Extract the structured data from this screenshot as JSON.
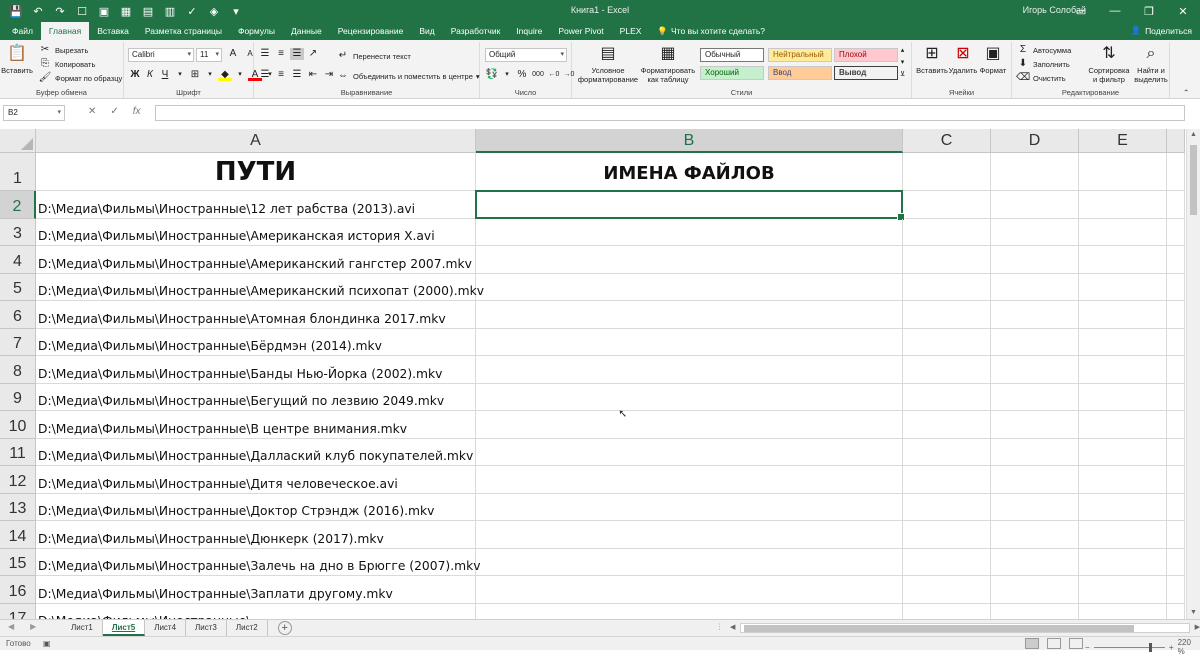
{
  "window": {
    "title": "Книга1  -  Excel",
    "user": "Игорь Солобай",
    "share": "Поделиться",
    "icons": [
      "save-icon",
      "undo-icon",
      "redo-icon",
      "form-icon",
      "image-icon",
      "table-icon",
      "grid-icon",
      "clipboard-icon",
      "spellcheck-icon",
      "tag-icon",
      "customize-qat-icon"
    ]
  },
  "tabs": [
    "Файл",
    "Главная",
    "Вставка",
    "Разметка страницы",
    "Формулы",
    "Данные",
    "Рецензирование",
    "Вид",
    "Разработчик",
    "Inquire",
    "Power Pivot",
    "PLEX"
  ],
  "active_tab": "Главная",
  "tellme": "Что вы хотите сделать?",
  "ribbon": {
    "clipboard": {
      "label": "Буфер обмена",
      "paste": "Вставить",
      "cut": "Вырезать",
      "copy": "Копировать",
      "format_painter": "Формат по образцу"
    },
    "font": {
      "label": "Шрифт",
      "name": "Calibri",
      "size": "11",
      "bold": "Ж",
      "italic": "К",
      "underline": "Ч"
    },
    "alignment": {
      "label": "Выравнивание",
      "wrap": "Перенести текст",
      "merge": "Объединить и поместить в центре"
    },
    "number": {
      "label": "Число",
      "format": "Общий",
      "percent": "%",
      "comma": "000"
    },
    "styles": {
      "label": "Стили",
      "conditional": "Условное форматирование",
      "as_table": "Форматировать как таблицу",
      "normal": "Обычный",
      "neutral": "Нейтральный",
      "bad": "Плохой",
      "good": "Хороший",
      "input": "Ввод",
      "output": "Вывод",
      "colors": {
        "neutral_bg": "#ffeb9c",
        "neutral_fg": "#9c5700",
        "bad_bg": "#ffc7ce",
        "bad_fg": "#9c0006",
        "good_bg": "#c6efce",
        "good_fg": "#006100",
        "input_bg": "#ffcc99",
        "input_fg": "#3f3f76"
      }
    },
    "cells": {
      "label": "Ячейки",
      "insert": "Вставить",
      "delete": "Удалить",
      "format": "Формат"
    },
    "editing": {
      "label": "Редактирование",
      "autosum": "Автосумма",
      "fill": "Заполнить",
      "clear": "Очистить",
      "sort": "Сортировка и фильтр",
      "find": "Найти и выделить"
    }
  },
  "formula_bar": {
    "name_box": "B2",
    "cancel": "✕",
    "enter": "✓",
    "fx": "fx",
    "value": ""
  },
  "grid": {
    "columns": [
      "A",
      "B",
      "C",
      "D",
      "E"
    ],
    "selected_column": "B",
    "selected_row": 2,
    "rows": [
      {
        "n": "1",
        "a": "ПУТИ",
        "b": "ИМЕНА ФАЙЛОВ"
      },
      {
        "n": "2",
        "a": "D:\\Медиа\\Фильмы\\Иностранные\\12 лет рабства (2013).avi",
        "b": ""
      },
      {
        "n": "3",
        "a": "D:\\Медиа\\Фильмы\\Иностранные\\Американская история X.avi",
        "b": ""
      },
      {
        "n": "4",
        "a": "D:\\Медиа\\Фильмы\\Иностранные\\Американский гангстер 2007.mkv",
        "b": ""
      },
      {
        "n": "5",
        "a": "D:\\Медиа\\Фильмы\\Иностранные\\Американский психопат (2000).mkv",
        "b": ""
      },
      {
        "n": "6",
        "a": "D:\\Медиа\\Фильмы\\Иностранные\\Атомная блондинка 2017.mkv",
        "b": ""
      },
      {
        "n": "7",
        "a": "D:\\Медиа\\Фильмы\\Иностранные\\Бёрдмэн (2014).mkv",
        "b": ""
      },
      {
        "n": "8",
        "a": "D:\\Медиа\\Фильмы\\Иностранные\\Банды Нью-Йорка (2002).mkv",
        "b": ""
      },
      {
        "n": "9",
        "a": "D:\\Медиа\\Фильмы\\Иностранные\\Бегущий по лезвию 2049.mkv",
        "b": ""
      },
      {
        "n": "10",
        "a": "D:\\Медиа\\Фильмы\\Иностранные\\В центре внимания.mkv",
        "b": ""
      },
      {
        "n": "11",
        "a": "D:\\Медиа\\Фильмы\\Иностранные\\Даллаский клуб покупателей.mkv",
        "b": ""
      },
      {
        "n": "12",
        "a": "D:\\Медиа\\Фильмы\\Иностранные\\Дитя человеческое.avi",
        "b": ""
      },
      {
        "n": "13",
        "a": "D:\\Медиа\\Фильмы\\Иностранные\\Доктор Стрэндж (2016).mkv",
        "b": ""
      },
      {
        "n": "14",
        "a": "D:\\Медиа\\Фильмы\\Иностранные\\Дюнкерк (2017).mkv",
        "b": ""
      },
      {
        "n": "15",
        "a": "D:\\Медиа\\Фильмы\\Иностранные\\Залечь на дно в Брюгге (2007).mkv",
        "b": ""
      },
      {
        "n": "16",
        "a": "D:\\Медиа\\Фильмы\\Иностранные\\Заплати другому.mkv",
        "b": ""
      },
      {
        "n": "17",
        "a": "D:\\Медиа\\Фильмы\\Иностранные\\",
        "b": ""
      }
    ]
  },
  "sheets": [
    "Лист1",
    "Лист5",
    "Лист4",
    "Лист3",
    "Лист2"
  ],
  "active_sheet": "Лист5",
  "status": {
    "ready": "Готово",
    "zoom": "220 %"
  }
}
